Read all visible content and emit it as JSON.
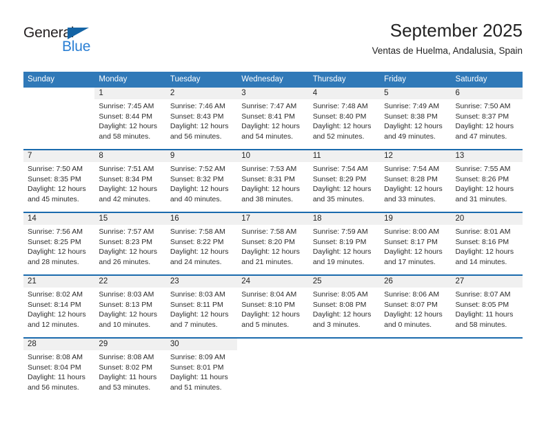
{
  "brand": {
    "name_part1": "General",
    "name_part2": "Blue",
    "triangle_icon": "triangle-icon",
    "color_dark": "#231f20",
    "color_blue": "#2a7fd4"
  },
  "header": {
    "title": "September 2025",
    "subtitle": "Ventas de Huelma, Andalusia, Spain"
  },
  "theme": {
    "header_blue": "#3079b8",
    "divider_blue": "#1a6aad",
    "day_band_gray": "#f0f0f0"
  },
  "calendar": {
    "weekdays": [
      "Sunday",
      "Monday",
      "Tuesday",
      "Wednesday",
      "Thursday",
      "Friday",
      "Saturday"
    ],
    "weeks": [
      [
        {
          "day": "",
          "lines": []
        },
        {
          "day": "1",
          "lines": [
            "Sunrise: 7:45 AM",
            "Sunset: 8:44 PM",
            "Daylight: 12 hours",
            "and 58 minutes."
          ]
        },
        {
          "day": "2",
          "lines": [
            "Sunrise: 7:46 AM",
            "Sunset: 8:43 PM",
            "Daylight: 12 hours",
            "and 56 minutes."
          ]
        },
        {
          "day": "3",
          "lines": [
            "Sunrise: 7:47 AM",
            "Sunset: 8:41 PM",
            "Daylight: 12 hours",
            "and 54 minutes."
          ]
        },
        {
          "day": "4",
          "lines": [
            "Sunrise: 7:48 AM",
            "Sunset: 8:40 PM",
            "Daylight: 12 hours",
            "and 52 minutes."
          ]
        },
        {
          "day": "5",
          "lines": [
            "Sunrise: 7:49 AM",
            "Sunset: 8:38 PM",
            "Daylight: 12 hours",
            "and 49 minutes."
          ]
        },
        {
          "day": "6",
          "lines": [
            "Sunrise: 7:50 AM",
            "Sunset: 8:37 PM",
            "Daylight: 12 hours",
            "and 47 minutes."
          ]
        }
      ],
      [
        {
          "day": "7",
          "lines": [
            "Sunrise: 7:50 AM",
            "Sunset: 8:35 PM",
            "Daylight: 12 hours",
            "and 45 minutes."
          ]
        },
        {
          "day": "8",
          "lines": [
            "Sunrise: 7:51 AM",
            "Sunset: 8:34 PM",
            "Daylight: 12 hours",
            "and 42 minutes."
          ]
        },
        {
          "day": "9",
          "lines": [
            "Sunrise: 7:52 AM",
            "Sunset: 8:32 PM",
            "Daylight: 12 hours",
            "and 40 minutes."
          ]
        },
        {
          "day": "10",
          "lines": [
            "Sunrise: 7:53 AM",
            "Sunset: 8:31 PM",
            "Daylight: 12 hours",
            "and 38 minutes."
          ]
        },
        {
          "day": "11",
          "lines": [
            "Sunrise: 7:54 AM",
            "Sunset: 8:29 PM",
            "Daylight: 12 hours",
            "and 35 minutes."
          ]
        },
        {
          "day": "12",
          "lines": [
            "Sunrise: 7:54 AM",
            "Sunset: 8:28 PM",
            "Daylight: 12 hours",
            "and 33 minutes."
          ]
        },
        {
          "day": "13",
          "lines": [
            "Sunrise: 7:55 AM",
            "Sunset: 8:26 PM",
            "Daylight: 12 hours",
            "and 31 minutes."
          ]
        }
      ],
      [
        {
          "day": "14",
          "lines": [
            "Sunrise: 7:56 AM",
            "Sunset: 8:25 PM",
            "Daylight: 12 hours",
            "and 28 minutes."
          ]
        },
        {
          "day": "15",
          "lines": [
            "Sunrise: 7:57 AM",
            "Sunset: 8:23 PM",
            "Daylight: 12 hours",
            "and 26 minutes."
          ]
        },
        {
          "day": "16",
          "lines": [
            "Sunrise: 7:58 AM",
            "Sunset: 8:22 PM",
            "Daylight: 12 hours",
            "and 24 minutes."
          ]
        },
        {
          "day": "17",
          "lines": [
            "Sunrise: 7:58 AM",
            "Sunset: 8:20 PM",
            "Daylight: 12 hours",
            "and 21 minutes."
          ]
        },
        {
          "day": "18",
          "lines": [
            "Sunrise: 7:59 AM",
            "Sunset: 8:19 PM",
            "Daylight: 12 hours",
            "and 19 minutes."
          ]
        },
        {
          "day": "19",
          "lines": [
            "Sunrise: 8:00 AM",
            "Sunset: 8:17 PM",
            "Daylight: 12 hours",
            "and 17 minutes."
          ]
        },
        {
          "day": "20",
          "lines": [
            "Sunrise: 8:01 AM",
            "Sunset: 8:16 PM",
            "Daylight: 12 hours",
            "and 14 minutes."
          ]
        }
      ],
      [
        {
          "day": "21",
          "lines": [
            "Sunrise: 8:02 AM",
            "Sunset: 8:14 PM",
            "Daylight: 12 hours",
            "and 12 minutes."
          ]
        },
        {
          "day": "22",
          "lines": [
            "Sunrise: 8:03 AM",
            "Sunset: 8:13 PM",
            "Daylight: 12 hours",
            "and 10 minutes."
          ]
        },
        {
          "day": "23",
          "lines": [
            "Sunrise: 8:03 AM",
            "Sunset: 8:11 PM",
            "Daylight: 12 hours",
            "and 7 minutes."
          ]
        },
        {
          "day": "24",
          "lines": [
            "Sunrise: 8:04 AM",
            "Sunset: 8:10 PM",
            "Daylight: 12 hours",
            "and 5 minutes."
          ]
        },
        {
          "day": "25",
          "lines": [
            "Sunrise: 8:05 AM",
            "Sunset: 8:08 PM",
            "Daylight: 12 hours",
            "and 3 minutes."
          ]
        },
        {
          "day": "26",
          "lines": [
            "Sunrise: 8:06 AM",
            "Sunset: 8:07 PM",
            "Daylight: 12 hours",
            "and 0 minutes."
          ]
        },
        {
          "day": "27",
          "lines": [
            "Sunrise: 8:07 AM",
            "Sunset: 8:05 PM",
            "Daylight: 11 hours",
            "and 58 minutes."
          ]
        }
      ],
      [
        {
          "day": "28",
          "lines": [
            "Sunrise: 8:08 AM",
            "Sunset: 8:04 PM",
            "Daylight: 11 hours",
            "and 56 minutes."
          ]
        },
        {
          "day": "29",
          "lines": [
            "Sunrise: 8:08 AM",
            "Sunset: 8:02 PM",
            "Daylight: 11 hours",
            "and 53 minutes."
          ]
        },
        {
          "day": "30",
          "lines": [
            "Sunrise: 8:09 AM",
            "Sunset: 8:01 PM",
            "Daylight: 11 hours",
            "and 51 minutes."
          ]
        },
        {
          "day": "",
          "lines": []
        },
        {
          "day": "",
          "lines": []
        },
        {
          "day": "",
          "lines": []
        },
        {
          "day": "",
          "lines": []
        }
      ]
    ]
  }
}
